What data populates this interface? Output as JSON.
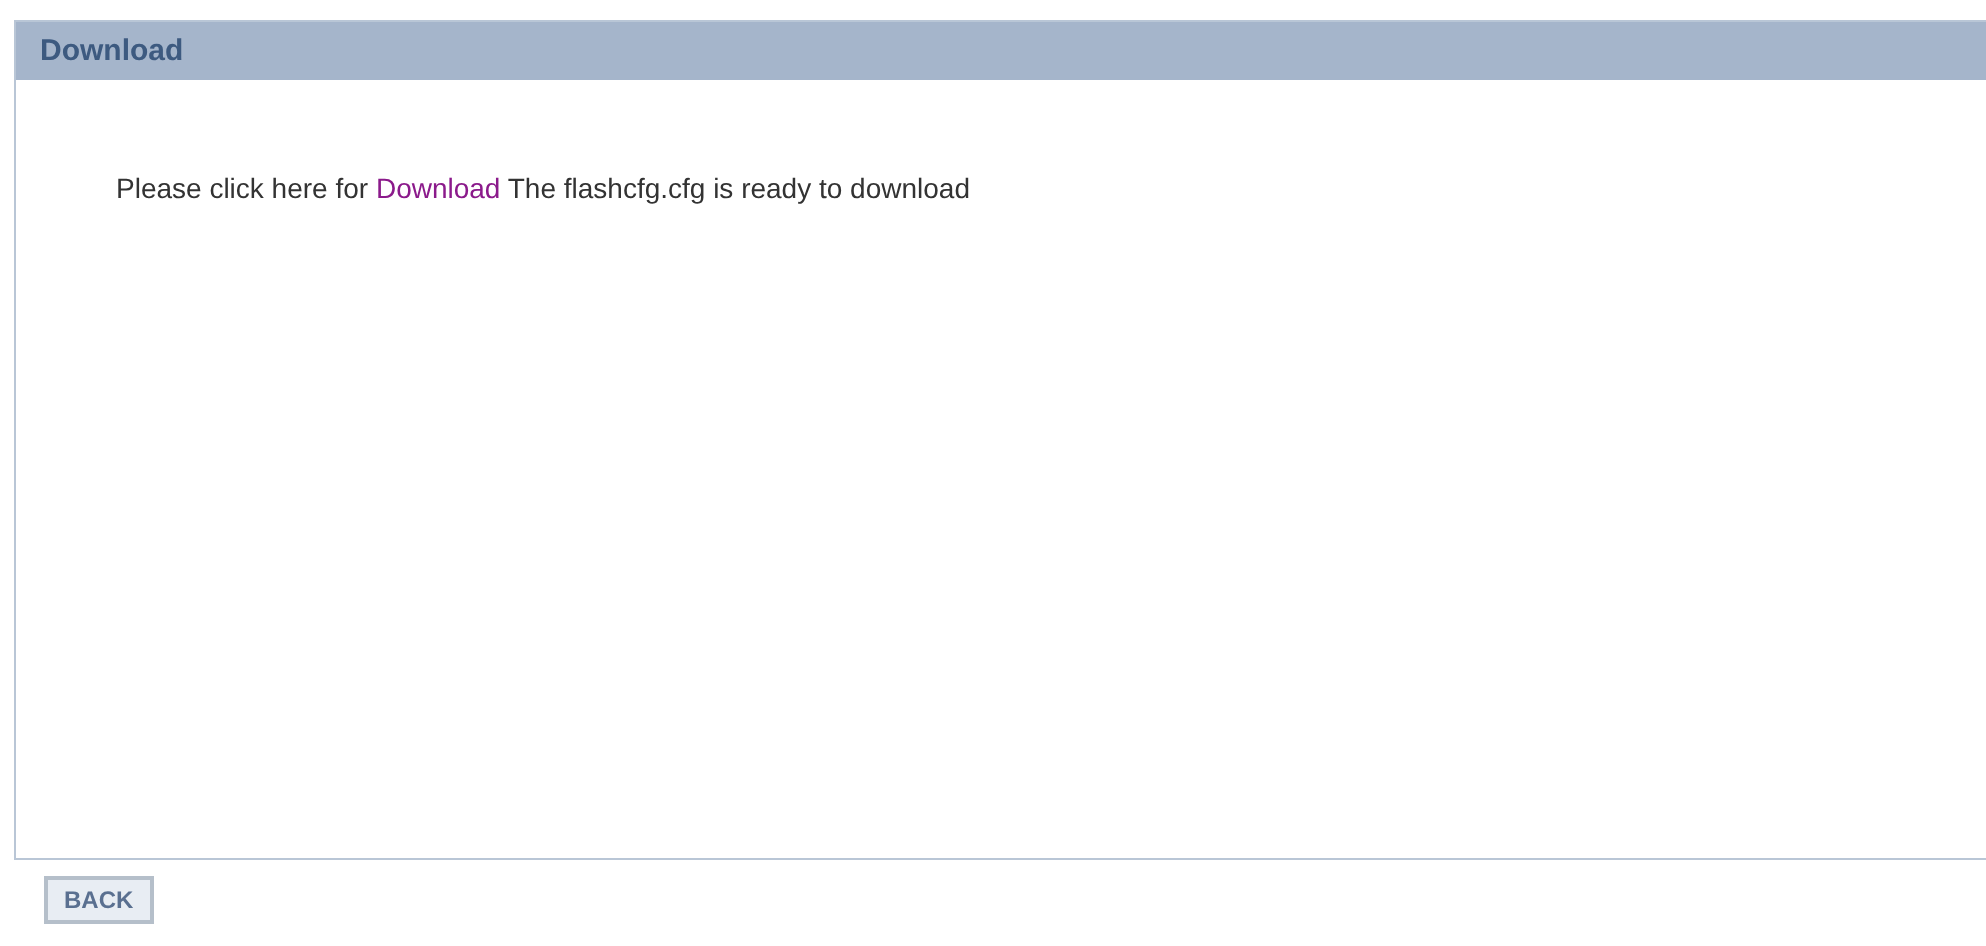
{
  "panel": {
    "title": "Download",
    "message": {
      "before": "Please click here for",
      "link": "Download",
      "after": "The flashcfg.cfg is ready to download"
    }
  },
  "buttons": [
    {
      "label": "BACK"
    }
  ]
}
